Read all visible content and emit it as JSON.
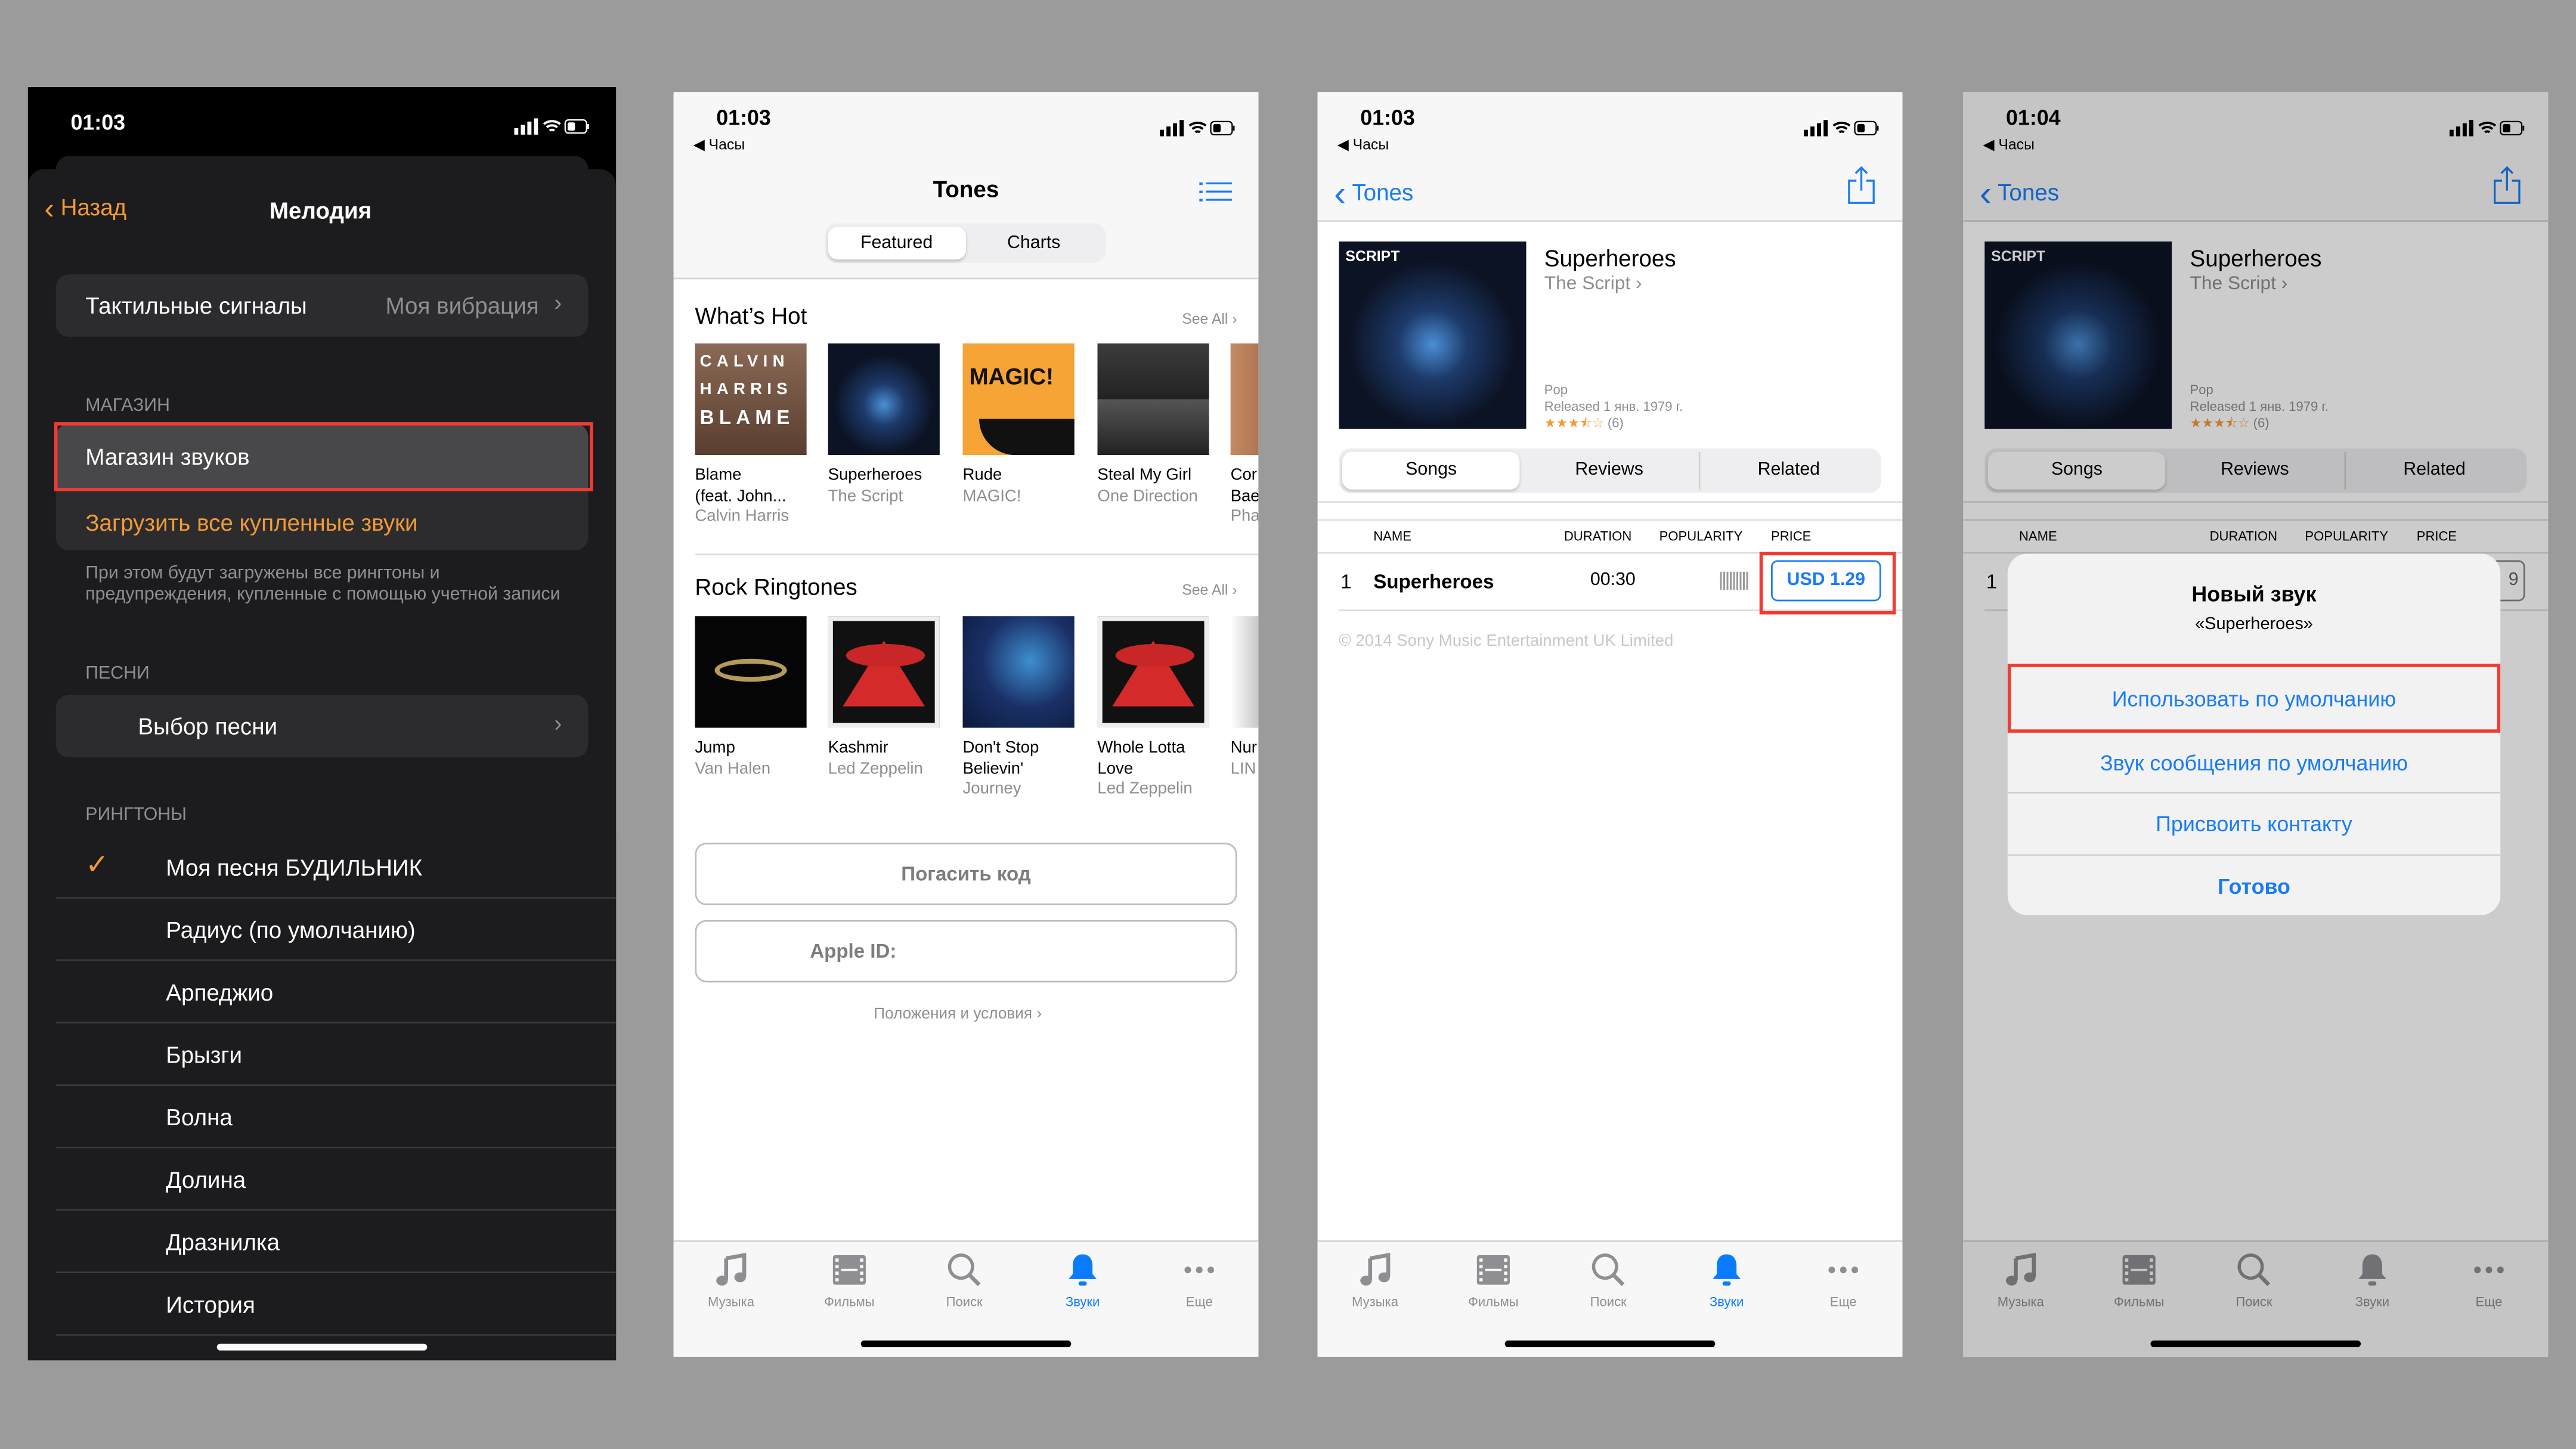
{
  "colors": {
    "ios_orange": "#f19a37",
    "ios_blue": "#1a7cf5",
    "highlight_red": "#f23a34",
    "dark_bg": "#1c1c1e"
  },
  "p1": {
    "time": "01:03",
    "back": "Назад",
    "title": "Мелодия",
    "haptics_label": "Тактильные сигналы",
    "haptics_value": "Моя вибрация",
    "store_section": "МАГАЗИН",
    "tone_store": "Магазин звуков",
    "download_all": "Загрузить все купленные звуки",
    "store_footer": "При этом будут загружены все рингтоны и предупреждения, купленные с помощью учетной записи",
    "songs_section": "ПЕСНИ",
    "pick_song": "Выбор песни",
    "ringtones_section": "РИНГТОНЫ",
    "ringtones": [
      {
        "label": "Моя песня БУДИЛЬНИК",
        "selected": true
      },
      {
        "label": "Радиус (по умолчанию)"
      },
      {
        "label": "Арпеджио"
      },
      {
        "label": "Брызги"
      },
      {
        "label": "Волна"
      },
      {
        "label": "Долина"
      },
      {
        "label": "Дразнилка"
      },
      {
        "label": "История"
      }
    ]
  },
  "p2": {
    "time": "01:03",
    "back_app": "◀ Часы",
    "title": "Tones",
    "segments": [
      "Featured",
      "Charts"
    ],
    "selected_segment": "Featured",
    "hot_title": "What’s Hot",
    "see_all": "See All",
    "hot": [
      {
        "l1": "Blame",
        "l2": "(feat. John...",
        "l3": "Calvin Harris",
        "art": "blame"
      },
      {
        "l1": "Superheroes",
        "l2": "The Script",
        "art": "script"
      },
      {
        "l1": "Rude",
        "l2": "MAGIC!",
        "art": "magic"
      },
      {
        "l1": "Steal My Girl",
        "l2": "One Direction",
        "art": "od"
      },
      {
        "l1": "Cor",
        "l2": "Bae",
        "l3": "Pha",
        "art": "partial"
      }
    ],
    "rock_title": "Rock Ringtones",
    "rock": [
      {
        "l1": "Jump",
        "l2": "Van Halen",
        "art": "vh"
      },
      {
        "l1": "Kashmir",
        "l2": "Led Zeppelin",
        "art": "lz"
      },
      {
        "l1": "Don't Stop",
        "l2": "Believin'",
        "l3": "Journey",
        "art": "journey"
      },
      {
        "l1": "Whole Lotta",
        "l2": "Love",
        "l3": "Led Zeppelin",
        "art": "lz"
      },
      {
        "l1": "Nur",
        "l2": "LIN",
        "art": "partial2"
      }
    ],
    "redeem": "Погасить код",
    "apple_id": "Apple ID:",
    "terms": "Положения и условия",
    "tabs": [
      "Музыка",
      "Фильмы",
      "Поиск",
      "Звуки",
      "Еще"
    ],
    "active_tab": "Звуки"
  },
  "p3": {
    "time": "01:03",
    "back_app": "◀ Часы",
    "back": "Tones",
    "song_title": "Superheroes",
    "artist": "The Script",
    "genre": "Pop",
    "released": "Released 1 янв. 1979 г.",
    "rating": 3.5,
    "rating_count": "(6)",
    "segments": [
      "Songs",
      "Reviews",
      "Related"
    ],
    "columns": [
      "NAME",
      "DURATION",
      "POPULARITY",
      "PRICE"
    ],
    "track": {
      "num": "1",
      "name": "Superheroes",
      "duration": "00:30",
      "price": "USD 1.29"
    },
    "copyright": "© 2014 Sony Music Entertainment UK Limited",
    "tabs": [
      "Музыка",
      "Фильмы",
      "Поиск",
      "Звуки",
      "Еще"
    ],
    "active_tab": "Звуки"
  },
  "p4": {
    "time": "01:04",
    "back_app": "◀ Часы",
    "back": "Tones",
    "song_title": "Superheroes",
    "artist": "The Script",
    "genre": "Pop",
    "released": "Released 1 янв. 1979 г.",
    "rating": 3.5,
    "rating_count": "(6)",
    "segments": [
      "Songs",
      "Reviews",
      "Related"
    ],
    "columns": [
      "NAME",
      "DURATION",
      "POPULARITY",
      "PRICE"
    ],
    "track": {
      "num": "1",
      "price_partial": "9"
    },
    "tabs": [
      "Музыка",
      "Фильмы",
      "Поиск",
      "Звуки",
      "Еще"
    ],
    "dialog": {
      "title": "Новый звук",
      "subtitle": "«Superheroes»",
      "actions": [
        "Использовать по умолчанию",
        "Звук сообщения по умолчанию",
        "Присвоить контакту",
        "Готово"
      ]
    }
  }
}
